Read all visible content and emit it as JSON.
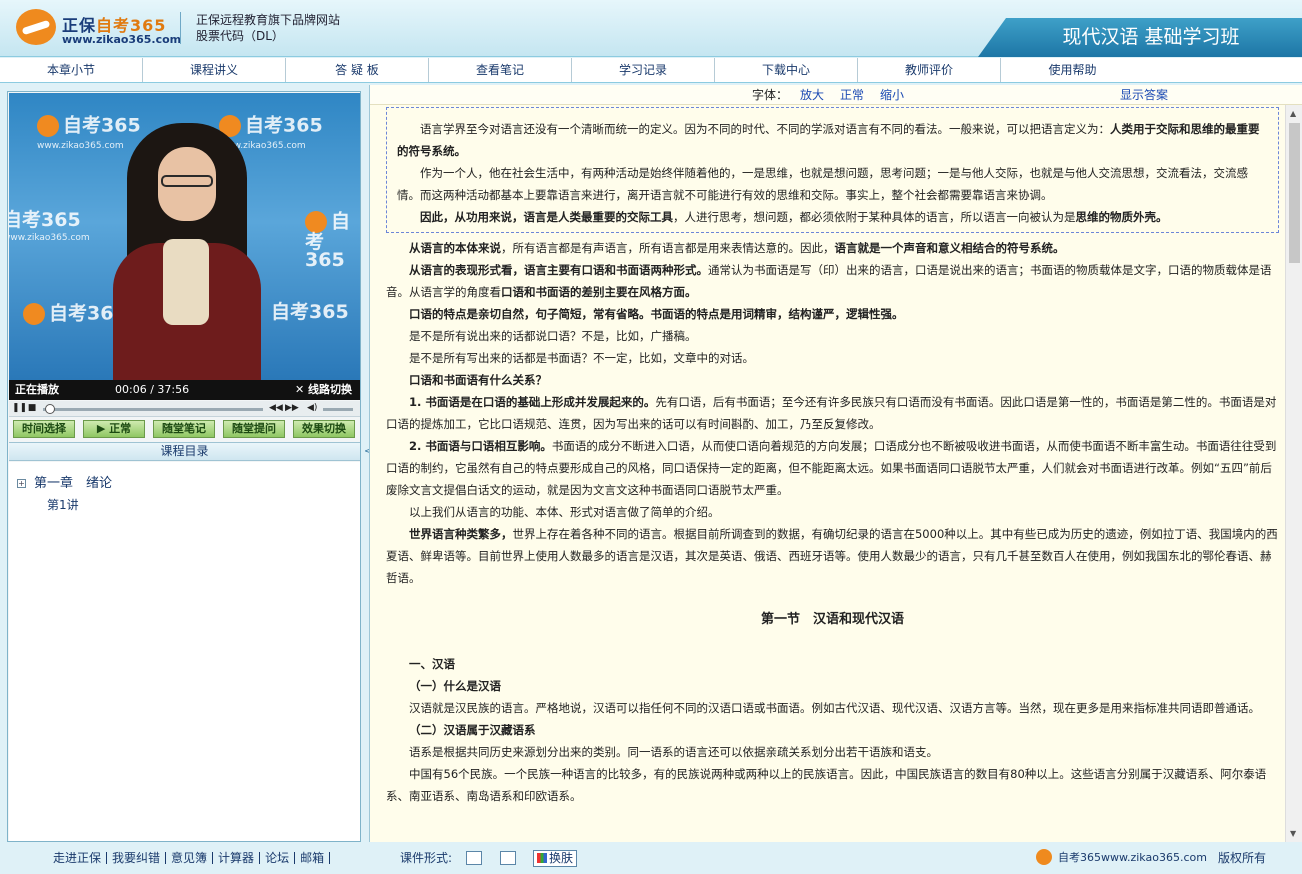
{
  "header": {
    "brand_name_a": "正保",
    "brand_name_b": "自考365",
    "brand_url": "www.zikao365.com",
    "tagline_1": "正保远程教育旗下品牌网站",
    "tagline_2": "股票代码（DL）",
    "course_title": "现代汉语 基础学习班"
  },
  "nav": [
    "本章小节",
    "课程讲义",
    "答 疑 板",
    "查看笔记",
    "学习记录",
    "下载中心",
    "教师评价",
    "使用帮助"
  ],
  "video": {
    "watermark_text": "自考365",
    "watermark_url": "www.zikao365.com",
    "status": "正在播放",
    "current_time": "00:06",
    "separator": "/",
    "total_time": "37:56",
    "mode": "线路切换",
    "progress": 0.003
  },
  "video_buttons": [
    "时间选择",
    "▶ 正常",
    "随堂笔记",
    "随堂提问",
    "效果切换"
  ],
  "catalog": {
    "title": "课程目录",
    "chapter": "第一章　绪论",
    "lecture": "第1讲"
  },
  "toolbar": {
    "font_label": "字体：",
    "large": "放大",
    "normal": "正常",
    "small": "缩小",
    "show_answer": "显示答案"
  },
  "content": {
    "box_p1_a": "语言学界至今对语言还没有一个清晰而统一的定义。因为不同的时代、不同的学派对语言有不同的看法。一般来说，可以把语言定义为：",
    "box_p1_b": "人类用于交际和思维的最重要的符号系统。",
    "box_p2": "作为一个人，他在社会生活中，有两种活动是始终伴随着他的，一是思维，也就是想问题，思考问题；一是与他人交际，也就是与他人交流思想，交流看法，交流感情。而这两种活动都基本上要靠语言来进行，离开语言就不可能进行有效的思维和交际。事实上，整个社会都需要靠语言来协调。",
    "box_p3_a": "因此，从功用来说，语言是人类最重要的交际工具",
    "box_p3_b": "，人进行思考，想问题，都必须依附于某种具体的语言，所以语言一向被认为是",
    "box_p3_c": "思维的物质外壳。",
    "p4_a": "从语言的本体来说",
    "p4_b": "，所有语言都是有声语言，所有语言都是用来表情达意的。因此，",
    "p4_c": "语言就是一个声音和意义相结合的符号系统。",
    "p5_a": "从语言的表现形式看，语言主要有口语和书面语两种形式。",
    "p5_b": "通常认为书面语是写（印）出来的语言，口语是说出来的语言；书面语的物质载体是文字，口语的物质载体是语音。从语言学的角度看",
    "p5_c": "口语和书面语的差别主要在风格方面。",
    "p6": "口语的特点是亲切自然，句子简短，常有省略。书面语的特点是用词精审，结构谨严，逻辑性强。",
    "p7": "是不是所有说出来的话都说口语？不是，比如，广播稿。",
    "p8": "是不是所有写出来的话都是书面语？不一定，比如，文章中的对话。",
    "p9": "口语和书面语有什么关系？",
    "p10_a": "1. 书面语是在口语的基础上形成并发展起来的。",
    "p10_b": "先有口语，后有书面语；至今还有许多民族只有口语而没有书面语。因此口语是第一性的，书面语是第二性的。书面语是对口语的提炼加工，它比口语规范、连贯，因为写出来的话可以有时间斟酌、加工，乃至反复修改。",
    "p11_a": "2. 书面语与口语相互影响。",
    "p11_b": "书面语的成分不断进入口语，从而使口语向着规范的方向发展；口语成分也不断被吸收进书面语，从而使书面语不断丰富生动。书面语往往受到口语的制约，它虽然有自己的特点要形成自己的风格，同口语保持一定的距离，但不能距离太远。如果书面语同口语脱节太严重，人们就会对书面语进行改革。例如“五四”前后废除文言文提倡白话文的运动，就是因为文言文这种书面语同口语脱节太严重。",
    "p12": "以上我们从语言的功能、本体、形式对语言做了简单的介绍。",
    "p13_a": "世界语言种类繁多，",
    "p13_b": "世界上存在着各种不同的语言。根据目前所调查到的数据，有确切纪录的语言在5000种以上。其中有些已成为历史的遗迹，例如拉丁语、我国境内的西夏语、鲜卑语等。目前世界上使用人数最多的语言是汉语，其次是英语、俄语、西班牙语等。使用人数最少的语言，只有几千甚至数百人在使用，例如我国东北的鄂伦春语、赫哲语。",
    "section_title": "第一节　汉语和现代汉语",
    "s1": "一、汉语",
    "s2": "（一）什么是汉语",
    "p14": "汉语就是汉民族的语言。严格地说，汉语可以指任何不同的汉语口语或书面语。例如古代汉语、现代汉语、汉语方言等。当然，现在更多是用来指标准共同语即普通话。",
    "s3": "（二）汉语属于汉藏语系",
    "p15": "语系是根据共同历史来源划分出来的类别。同一语系的语言还可以依据亲疏关系划分出若干语族和语支。",
    "p16": "中国有56个民族。一个民族一种语言的比较多，有的民族说两种或两种以上的民族语言。因此，中国民族语言的数目有80种以上。这些语言分别属于汉藏语系、阿尔泰语系、南亚语系、南岛语系和印欧语系。"
  },
  "footer": {
    "links": [
      "走进正保",
      "我要纠错",
      "意见簿",
      "计算器",
      "论坛",
      "邮箱"
    ],
    "type_label": "课件形式:",
    "skin": "换肤",
    "brand": "自考365www.zikao365.com",
    "copyright": "版权所有"
  },
  "colors": {
    "accent": "#1d76a6",
    "brand_orange": "#ef8a1e",
    "content_bg": "#fffdeb",
    "link_blue": "#1c4bb3"
  },
  "icons": [
    "logo-icon",
    "play-icon",
    "stop-icon",
    "prev-icon",
    "next-icon",
    "volume-icon",
    "expand-icon",
    "collapse-icon",
    "scroll-up-icon",
    "scroll-down-icon"
  ]
}
